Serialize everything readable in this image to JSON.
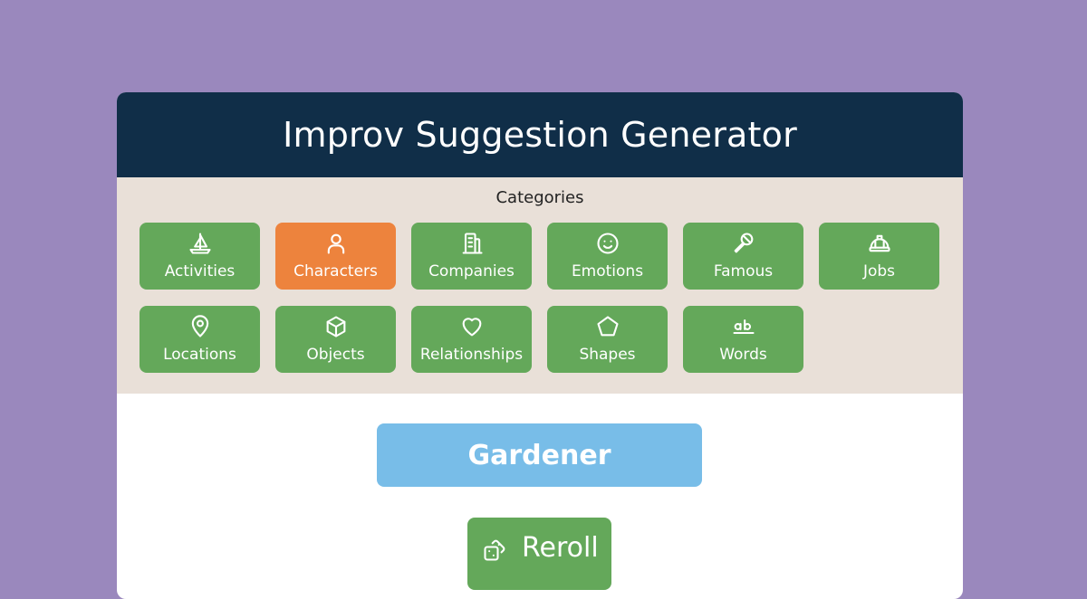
{
  "app": {
    "title": "Improv Suggestion Generator"
  },
  "categories": {
    "heading": "Categories",
    "items": [
      {
        "label": "Activities",
        "icon": "sailboat-icon",
        "active": false
      },
      {
        "label": "Characters",
        "icon": "person-icon",
        "active": true
      },
      {
        "label": "Companies",
        "icon": "building-icon",
        "active": false
      },
      {
        "label": "Emotions",
        "icon": "smiley-icon",
        "active": false
      },
      {
        "label": "Famous",
        "icon": "microphone-icon",
        "active": false
      },
      {
        "label": "Jobs",
        "icon": "hard-hat-icon",
        "active": false
      },
      {
        "label": "Locations",
        "icon": "map-pin-icon",
        "active": false
      },
      {
        "label": "Objects",
        "icon": "cube-icon",
        "active": false
      },
      {
        "label": "Relationships",
        "icon": "heart-icon",
        "active": false
      },
      {
        "label": "Shapes",
        "icon": "pentagon-icon",
        "active": false
      },
      {
        "label": "Words",
        "icon": "text-ab-icon",
        "active": false
      }
    ]
  },
  "suggestion": {
    "text": "Gardener"
  },
  "reroll": {
    "label": "Reroll",
    "icon": "dice-icon"
  },
  "colors": {
    "page_background": "#9a88bd",
    "header_background": "#102e48",
    "categories_background": "#e9e0d8",
    "category_button": "#64a85a",
    "category_button_active": "#ed833d",
    "suggestion_background": "#78bde8"
  }
}
